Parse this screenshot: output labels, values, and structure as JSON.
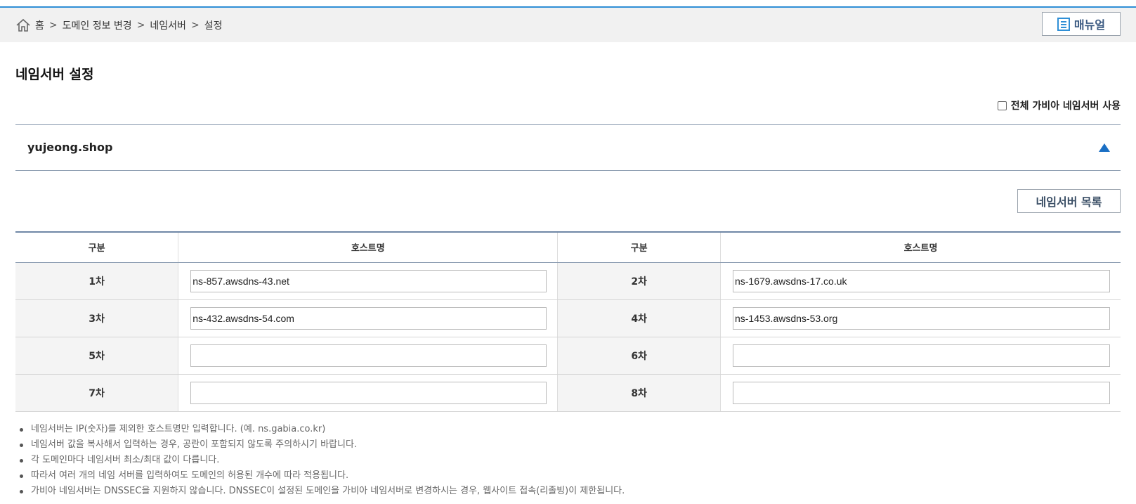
{
  "breadcrumb": {
    "home": "홈",
    "sep": ">",
    "items": [
      "도메인 정보 변경",
      "네임서버",
      "설정"
    ]
  },
  "manual_button": "매뉴얼",
  "page_title": "네임서버 설정",
  "all_gabia_label": "전체 가비아 네임서버 사용",
  "domain": "yujeong.shop",
  "ns_list_button": "네임서버 목록",
  "table": {
    "headers": [
      "구분",
      "호스트명",
      "구분",
      "호스트명"
    ],
    "rows": [
      {
        "l1": "1차",
        "v1": "ns-857.awsdns-43.net",
        "l2": "2차",
        "v2": "ns-1679.awsdns-17.co.uk"
      },
      {
        "l1": "3차",
        "v1": "ns-432.awsdns-54.com",
        "l2": "4차",
        "v2": "ns-1453.awsdns-53.org"
      },
      {
        "l1": "5차",
        "v1": "",
        "l2": "6차",
        "v2": ""
      },
      {
        "l1": "7차",
        "v1": "",
        "l2": "8차",
        "v2": ""
      }
    ]
  },
  "notes": [
    "네임서버는 IP(숫자)를 제외한 호스트명만 입력합니다. (예. ns.gabia.co.kr)",
    "네임서버 값을 복사해서 입력하는 경우, 공란이 포함되지 않도록 주의하시기 바랍니다.",
    "각 도메인마다 네임서버 최소/최대 값이 다릅니다.",
    "따라서 여러 개의 네임 서버를 입력하여도 도메인의 허용된 개수에 따라 적용됩니다.",
    "가비아 네임서버는 DNSSEC을 지원하지 않습니다. DNSSEC이 설정된 도메인을 가비아 네임서버로 변경하시는 경우, 웹사이트 접속(리졸빙)이 제한됩니다."
  ],
  "colors": {
    "accent": "#2f8fd6",
    "arrow": "#1a6fc4",
    "button_text": "#3b5a82"
  },
  "icons": {
    "home": "home-icon",
    "manual": "document-list-icon",
    "collapse": "triangle-up-icon"
  }
}
